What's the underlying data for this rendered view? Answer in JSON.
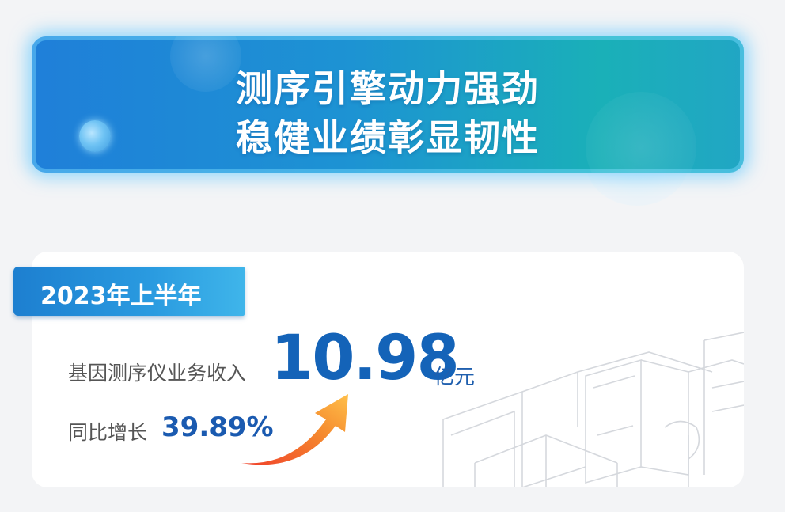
{
  "banner": {
    "line1": "测序引擎动力强劲",
    "line2": "稳健业绩彰显韧性"
  },
  "card": {
    "period": "2023年上半年",
    "revenue_label": "基因测序仪业务收入",
    "revenue_value": "10.98",
    "revenue_unit": "亿元",
    "yoy_label": "同比增长",
    "yoy_value": "39.89%"
  },
  "colors": {
    "banner_start": "#1f7fd9",
    "banner_end": "#1ab0b8",
    "value_blue": "#1463b8",
    "arrow": "#f06a2a"
  },
  "icons": [
    "growth-arrow-icon",
    "lab-equipment-illustration"
  ]
}
